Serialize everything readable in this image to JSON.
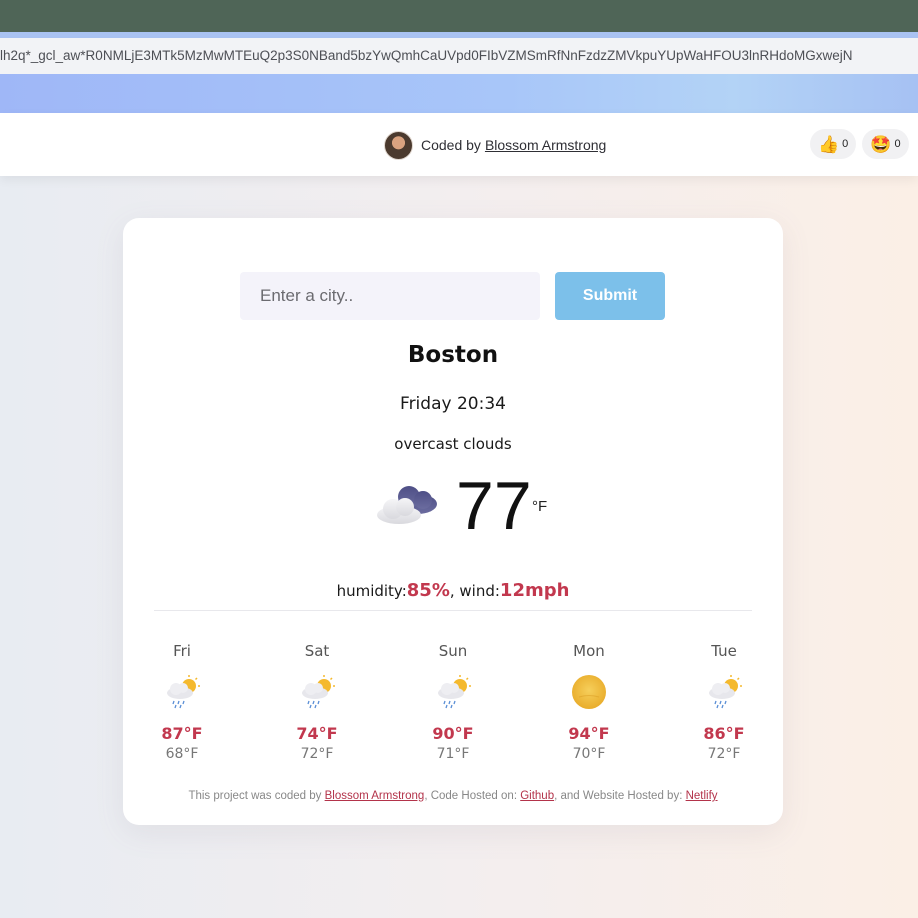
{
  "browser": {
    "url_fragment": "lh2q*_gcl_aw*R0NMLjE3MTk5MzMwMTEuQ2p3S0NBand5bzYwQmhCaUVpd0FIbVZMSmRfNnFzdzZMVkpuYUpWaHFOU3lnRHdoMGxwejN"
  },
  "header": {
    "coded_by_label": "Coded by",
    "author": "Blossom Armstrong",
    "reactions": [
      {
        "icon": "thumbs-up-icon",
        "glyph": "👍",
        "count": "0"
      },
      {
        "icon": "star-struck-icon",
        "glyph": "🤩",
        "count": "0"
      }
    ]
  },
  "search": {
    "placeholder": "Enter a city..",
    "value": "",
    "submit_label": "Submit"
  },
  "current": {
    "city": "Boston",
    "datetime": "Friday 20:34",
    "description": "overcast clouds",
    "icon": "overcast-clouds-icon",
    "temperature": "77",
    "unit": "°F",
    "humidity_label": "humidity:",
    "humidity": "85%",
    "wind_label": ", wind:",
    "wind": "12mph"
  },
  "forecast": [
    {
      "day": "Fri",
      "icon": "sun-rain-icon",
      "max": "87°F",
      "min": "68°F"
    },
    {
      "day": "Sat",
      "icon": "sun-rain-icon",
      "max": "74°F",
      "min": "72°F"
    },
    {
      "day": "Sun",
      "icon": "sun-rain-icon",
      "max": "90°F",
      "min": "71°F"
    },
    {
      "day": "Mon",
      "icon": "sun-icon",
      "max": "94°F",
      "min": "70°F"
    },
    {
      "day": "Tue",
      "icon": "sun-rain-icon",
      "max": "86°F",
      "min": "72°F"
    }
  ],
  "footer": {
    "part1": "This project was coded by ",
    "author": "Blossom Armstrong",
    "part2": ", Code Hosted on: ",
    "code_host": "Github",
    "part3": ", and Website Hosted by: ",
    "web_host": "Netlify"
  },
  "colors": {
    "accent": "#c2384e",
    "submit": "#7cc0ea",
    "topbar": "#4f6557"
  }
}
